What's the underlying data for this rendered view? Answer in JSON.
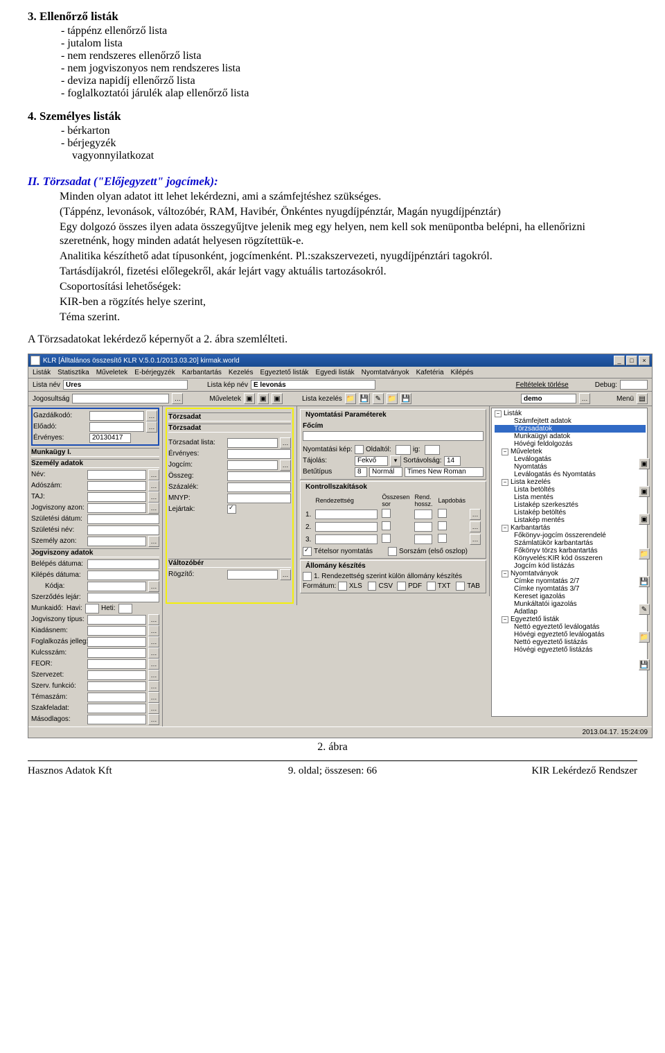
{
  "doc": {
    "s3_title": "3. Ellenőrző listák",
    "s3_items": [
      "táppénz ellenőrző lista",
      "jutalom lista",
      "nem rendszeres ellenőrző lista",
      "nem jogviszonyos nem rendszeres lista",
      "deviza napidíj ellenőrző lista",
      "foglalkoztatói járulék alap ellenőrző lista"
    ],
    "s4_title": "4. Személyes listák",
    "s4_items": [
      "bérkarton",
      "bérjegyzék"
    ],
    "s4_extra": "vagyonnyilatkozat",
    "II_title": "II. Törzsadat (\"Előjegyzett\" jogcímek):",
    "II_p1": "Minden olyan adatot itt lehet lekérdezni, ami a számfejtéshez szükséges.",
    "II_p2": "(Táppénz, levonások, változóbér, RAM, Havibér, Önkéntes nyugdíjpénztár, Magán nyugdíjpénztár)",
    "II_p3": "Egy dolgozó összes ilyen adata összegyűjtve jelenik meg egy helyen, nem kell sok menüpontba belépni, ha ellenőrizni szeretnénk, hogy minden adatát helyesen rögzítettük-e.",
    "II_p4": "Analitika készíthető adat típusonként, jogcímenként. Pl.:szakszervezeti, nyugdíjpénztári tagokról.",
    "II_p5": "Tartásdíjakról, fizetési előlegekről, akár lejárt vagy aktuális tartozásokról.",
    "II_p6": "Csoportosítási lehetőségek:",
    "II_p7": "KIR-ben a rögzítés helye szerint,",
    "II_p8": "Téma szerint.",
    "lead": "A Törzsadatokat lekérdező képernyőt a 2. ábra szemlélteti.",
    "caption": "2. ábra",
    "footer_left": "Hasznos Adatok Kft",
    "footer_mid": "9. oldal; összesen: 66",
    "footer_right": "KIR Lekérdező Rendszer"
  },
  "app": {
    "title": "KLR  [Álltalános összesítő KLR V.5.0.1/2013.03.20]  kirmak.world",
    "menu": [
      "Listák",
      "Statisztika",
      "Műveletek",
      "E-bérjegyzék",
      "Karbantartás",
      "Kezelés",
      "Egyeztető listák",
      "Egyedi listák",
      "Nyomtatványok",
      "Kafetéria",
      "Kilépés"
    ],
    "tb1": {
      "listanev": "Lista név",
      "listanev_v": "Üres",
      "listakepnev": "Lista kép név",
      "listakepnev_v": "E levonás",
      "feltetelek": "Feltételek törlése",
      "debug": "Debug:"
    },
    "tb2": {
      "jogosultsag": "Jogosultság",
      "muveletek": "Műveletek",
      "listakezeles": "Lista kezelés",
      "demo": "demo",
      "menu": "Menü"
    },
    "col1": {
      "gazd": "Gazdálkodó:",
      "eloado": "Előadó:",
      "ervenyes": "Érvényes:",
      "ervenyes_v": "20130417",
      "munkaugy": "Munkaügy I.",
      "szemely": "Személy adatok",
      "nev": "Név:",
      "adoszam": "Adószám:",
      "taj": "TAJ:",
      "jvazon": "Jogviszony azon:",
      "szuldatum": "Születési dátum:",
      "szulnev": "Születési név:",
      "szemazon": "Személy azon:",
      "jogviszony": "Jogviszony adatok",
      "belepes": "Belépés dátuma:",
      "kilepes": "Kilépés dátuma:",
      "kodja": "Kódja:",
      "szerzodes": "Szerződés lejár:",
      "munkaido": "Munkaidő:",
      "havi": "Havi:",
      "heti": "Heti:",
      "jvtipus": "Jogviszony típus:",
      "kiadasnem": "Kiadásnem:",
      "foglalkozas": "Foglalkozás jelleg:",
      "kulcsszam": "Kulcsszám:",
      "feor": "FEOR:",
      "szervezet": "Szervezet:",
      "szervfunk": "Szerv. funkció:",
      "temaszam": "Témaszám:",
      "szakfeladat": "Szakfeladat:",
      "masodlagos": "Másodlagos:"
    },
    "col2": {
      "torzsadat": "Törzsadat",
      "torzsadat2": "Törzsadat",
      "torzslista": "Törzsadat lista:",
      "ervenyes": "Érvényes:",
      "jogcim": "Jogcím:",
      "osszeg": "Összeg:",
      "szazalek": "Százalék:",
      "mnyp": "MNYP:",
      "lejartak": "Lejártak:",
      "valtozober": "Változóbér",
      "rogzito": "Rögzítő:"
    },
    "col3": {
      "nyparam": "Nyomtatási Paraméterek",
      "focim": "Főcím",
      "nyomtkep": "Nyomtatási kép:",
      "oldaltol": "Oldaltól:",
      "ig": "ig:",
      "tajolas": "Tájolás:",
      "tajolas_v": "Fekvő",
      "sortav": "Sortávolság:",
      "sortav_v": "14",
      "betutipus": "Betűtípus",
      "betusize": "8",
      "betustyle": "Normál",
      "betufont": "Times New Roman",
      "kontroll": "Kontrollszakítások",
      "rendh": "Rendezettség",
      "osszesen": "Összesen sor",
      "rendhossz": "Rend. hossz.",
      "lapdobas": "Lapdobás",
      "tetelsor": "Tételsor nyomtatás",
      "sorszam": "Sorszám (első oszlop)",
      "allomany": "Állomány készítés",
      "allrow": "1. Rendezettség szerint külön állomány készítés",
      "formatum": "Formátum:",
      "fmts": [
        "XLS",
        "CSV",
        "PDF",
        "TXT",
        "TAB"
      ]
    },
    "tree": {
      "root": "Listák",
      "items1": [
        "Számfejtett adatok",
        "Törzsadatok",
        "Munkaügyi adatok",
        "Hóvégi feldolgozás"
      ],
      "muveletek": "Műveletek",
      "items2": [
        "Leválogatás",
        "Nyomtatás",
        "Leválogatás és Nyomtatás"
      ],
      "listakezeles": "Lista kezelés",
      "items3": [
        "Lista betöltés",
        "Lista mentés",
        "Listakép szerkesztés",
        "Listakép betöltés",
        "Listakép mentés"
      ],
      "karbantartas": "Karbantartás",
      "items4": [
        "Főkönyv-jogcím összerendelé",
        "Számlatükör karbantartás",
        "Főkönyv törzs karbantartás",
        "Könyvelés:KIR kód összeren",
        "Jogcím kód listázás"
      ],
      "nyomt": "Nyomtatványok",
      "items5": [
        "Címke nyomtatás 2/7",
        "Címke nyomtatás 3/7",
        "Kereset igazolás",
        "Munkáltatói igazolás",
        "Adatlap"
      ],
      "egyeztet": "Egyeztető listák",
      "items6": [
        "Nettó egyeztető leválogatás",
        "Hóvégi egyeztető leválogatás",
        "Nettó egyeztető listázás",
        "Hóvégi egyeztető listázás"
      ]
    },
    "status": "2013.04.17.  15:24:09"
  }
}
